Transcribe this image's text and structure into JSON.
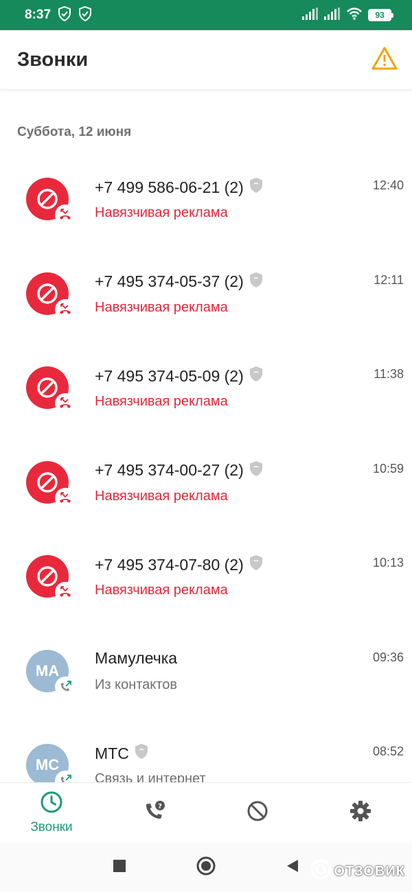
{
  "status_bar": {
    "time": "8:37",
    "battery": "93"
  },
  "app_bar": {
    "title": "Звонки"
  },
  "section": {
    "date": "Суббота, 12 июня"
  },
  "calls": [
    {
      "name": "+7 499 586-06-21 (2)",
      "subtitle": "Навязчивая реклама",
      "time": "12:40",
      "kind": "spam"
    },
    {
      "name": "+7 495 374-05-37 (2)",
      "subtitle": "Навязчивая реклама",
      "time": "12:11",
      "kind": "spam"
    },
    {
      "name": "+7 495 374-05-09 (2)",
      "subtitle": "Навязчивая реклама",
      "time": "11:38",
      "kind": "spam"
    },
    {
      "name": "+7 495 374-00-27 (2)",
      "subtitle": "Навязчивая реклама",
      "time": "10:59",
      "kind": "spam"
    },
    {
      "name": "+7 495 374-07-80 (2)",
      "subtitle": "Навязчивая реклама",
      "time": "10:13",
      "kind": "spam"
    },
    {
      "name": "Мамулечка",
      "subtitle": "Из контактов",
      "time": "09:36",
      "kind": "contact",
      "initials": "МА"
    },
    {
      "name": "МТС",
      "subtitle": "Связь и интернет",
      "time": "08:52",
      "kind": "contact",
      "initials": "МС"
    }
  ],
  "bottom_nav": {
    "calls_label": "Звонки"
  },
  "watermark": {
    "text": "ОТЗОВИК"
  },
  "colors": {
    "status_bar": "#178a5c",
    "spam": "#e3283b",
    "accent": "#1a9b78",
    "contact_avatar": "#9cbad3"
  }
}
